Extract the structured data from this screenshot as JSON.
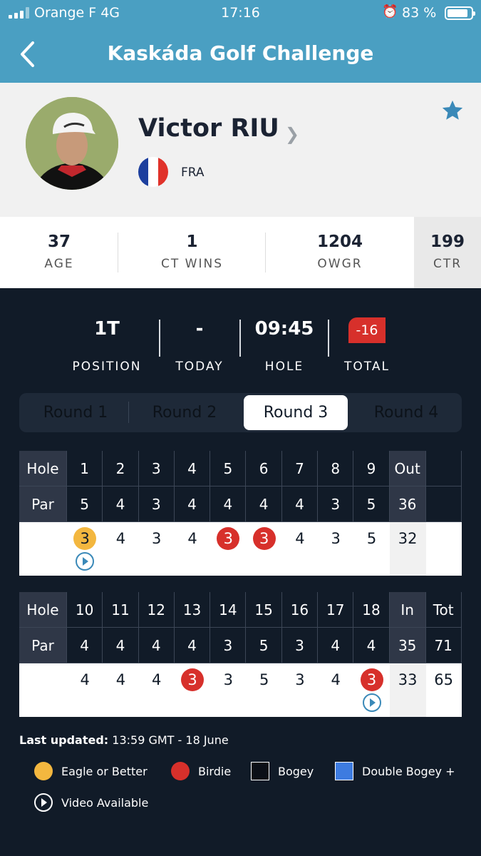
{
  "status_bar": {
    "carrier": "Orange F  4G",
    "time": "17:16",
    "battery_pct": "83 %"
  },
  "header": {
    "title": "Kaskáda Golf Challenge"
  },
  "player": {
    "name": "Victor RIU",
    "country": "FRA",
    "flag_colors": [
      "#1d3f9e",
      "#ffffff",
      "#e0322a"
    ]
  },
  "stats": [
    {
      "value": "37",
      "label": "AGE"
    },
    {
      "value": "1",
      "label": "CT WINS"
    },
    {
      "value": "1204",
      "label": "OWGR"
    },
    {
      "value": "199",
      "label": "CTR"
    }
  ],
  "summary": {
    "position": {
      "value": "1T",
      "label": "POSITION"
    },
    "today": {
      "value": "-",
      "label": "TODAY"
    },
    "hole": {
      "value": "09:45",
      "label": "HOLE"
    },
    "total": {
      "value": "-16",
      "label": "TOTAL"
    }
  },
  "rounds": [
    "Round 1",
    "Round 2",
    "Round 3",
    "Round 4"
  ],
  "active_round": "Round 3",
  "front_nine": {
    "hole_label": "Hole",
    "par_label": "Par",
    "holes": [
      "1",
      "2",
      "3",
      "4",
      "5",
      "6",
      "7",
      "8",
      "9"
    ],
    "pars": [
      "5",
      "4",
      "3",
      "4",
      "4",
      "4",
      "4",
      "3",
      "5"
    ],
    "scores": [
      "3",
      "4",
      "3",
      "4",
      "3",
      "3",
      "4",
      "3",
      "5"
    ],
    "result": [
      "eagle",
      "",
      "",
      "",
      "birdie",
      "birdie",
      "",
      "",
      ""
    ],
    "video": [
      true,
      false,
      false,
      false,
      false,
      false,
      false,
      false,
      false
    ],
    "sub_label": "Out",
    "sub_par": "36",
    "sub_score": "32"
  },
  "back_nine": {
    "hole_label": "Hole",
    "par_label": "Par",
    "holes": [
      "10",
      "11",
      "12",
      "13",
      "14",
      "15",
      "16",
      "17",
      "18"
    ],
    "pars": [
      "4",
      "4",
      "4",
      "4",
      "3",
      "5",
      "3",
      "4",
      "4"
    ],
    "scores": [
      "4",
      "4",
      "4",
      "3",
      "3",
      "5",
      "3",
      "4",
      "3"
    ],
    "result": [
      "",
      "",
      "",
      "birdie",
      "",
      "",
      "",
      "",
      "birdie"
    ],
    "video": [
      false,
      false,
      false,
      false,
      false,
      false,
      false,
      false,
      true
    ],
    "sub_label": "In",
    "sub_par": "35",
    "sub_score": "33",
    "tot_label": "Tot",
    "tot_par": "71",
    "tot_score": "65"
  },
  "footer": {
    "updated_label": "Last updated:",
    "updated_value": " 13:59 GMT - 18 June"
  },
  "legend": [
    {
      "label": "Eagle or Better",
      "color": "#f3b73f",
      "shape": "circle"
    },
    {
      "label": "Birdie",
      "color": "#d7302b",
      "shape": "circle"
    },
    {
      "label": "Bogey",
      "color": "#0b0f17",
      "shape": "square"
    },
    {
      "label": "Double Bogey +",
      "color": "#3d7be0",
      "shape": "square"
    }
  ],
  "legend_video": "Video Available",
  "colors": {
    "header": "#4a9fc2",
    "background": "#111b28",
    "eagle": "#f3b73f",
    "birdie": "#d7302b",
    "star": "#3a89b8"
  }
}
